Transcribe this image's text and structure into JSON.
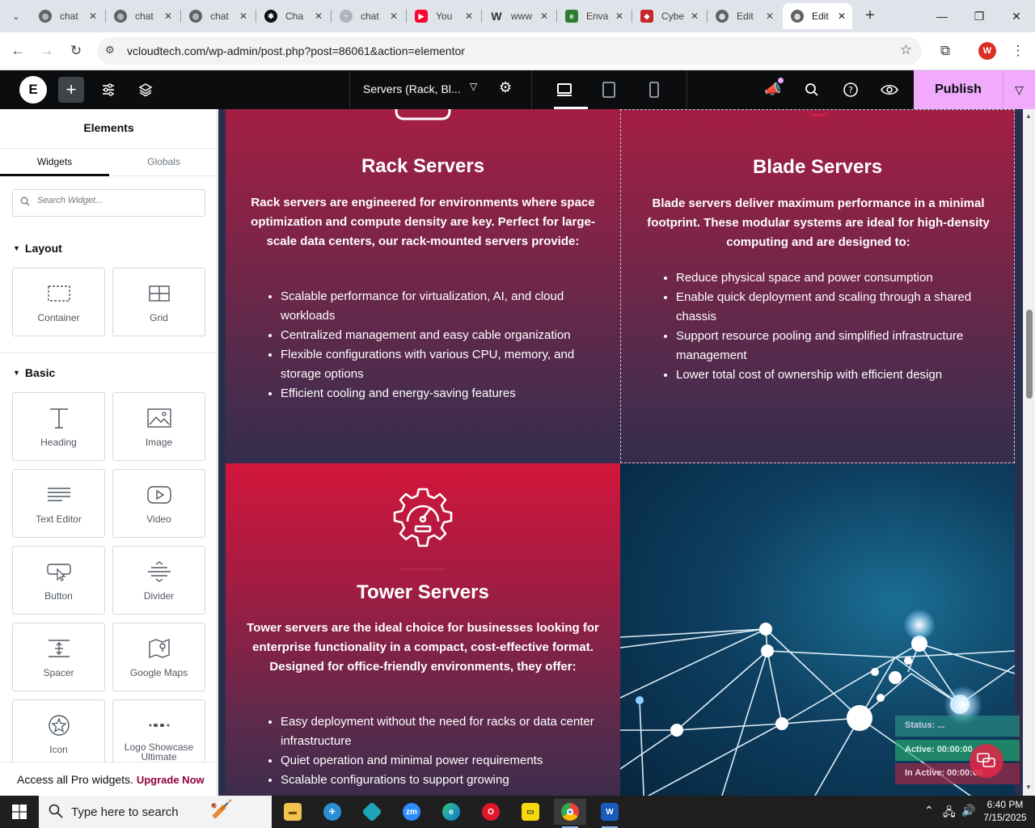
{
  "browser": {
    "tabs": [
      {
        "title": "chat",
        "icon": "openai-icon",
        "active": false
      },
      {
        "title": "chat",
        "icon": "openai-icon",
        "active": false
      },
      {
        "title": "chat",
        "icon": "openai-icon",
        "active": false
      },
      {
        "title": "Cha",
        "icon": "chatgpt-icon",
        "active": false
      },
      {
        "title": "chat",
        "icon": "deepseek-icon",
        "active": false
      },
      {
        "title": "You",
        "icon": "youtube-icon",
        "active": false
      },
      {
        "title": "www",
        "icon": "wordpress-icon",
        "active": false
      },
      {
        "title": "Enva",
        "icon": "envato-icon",
        "active": false
      },
      {
        "title": "Cybe",
        "icon": "cyber-icon",
        "active": false
      },
      {
        "title": "Edit",
        "icon": "globe-icon",
        "active": false
      },
      {
        "title": "Edit",
        "icon": "globe-icon",
        "active": true
      }
    ],
    "url": "vcloudtech.com/wp-admin/post.php?post=86061&action=elementor",
    "profile_initial": "W"
  },
  "elementor": {
    "logo": "E",
    "document_title": "Servers (Rack, Bl...",
    "publish_label": "Publish",
    "panel": {
      "title": "Elements",
      "tabs": [
        "Widgets",
        "Globals"
      ],
      "search_placeholder": "Search Widget...",
      "categories": {
        "layout": {
          "title": "Layout",
          "widgets": [
            "Container",
            "Grid"
          ]
        },
        "basic": {
          "title": "Basic",
          "widgets": [
            "Heading",
            "Image",
            "Text Editor",
            "Video",
            "Button",
            "Divider",
            "Spacer",
            "Google Maps",
            "Icon",
            "Logo Showcase Ultimate"
          ]
        }
      },
      "promo_text": "Access all Pro widgets.",
      "promo_link": "Upgrade Now"
    }
  },
  "canvas": {
    "rack": {
      "title": "Rack Servers",
      "description": "Rack servers are engineered for environments where space optimization and compute density are key. Perfect for large-scale data centers, our rack-mounted servers provide:",
      "items": [
        "Scalable performance for virtualization, AI, and cloud workloads",
        "Centralized management and easy cable organization",
        "Flexible configurations with various CPU, memory, and storage options",
        "Efficient cooling and energy-saving features"
      ]
    },
    "blade": {
      "title": "Blade Servers",
      "description": "Blade servers deliver maximum performance in a minimal footprint. These modular systems are ideal for high-density computing and are designed to:",
      "items": [
        "Reduce physical space and power consumption",
        "Enable quick deployment and scaling through a shared chassis",
        "Support resource pooling and simplified infrastructure management",
        "Lower total cost of ownership with efficient design"
      ]
    },
    "tower": {
      "title": "Tower Servers",
      "description": "Tower servers are the ideal choice for businesses looking for enterprise functionality in a compact, cost-effective format. Designed for office-friendly environments, they offer:",
      "items": [
        "Easy deployment without the need for racks or data center infrastructure",
        "Quiet operation and minimal power requirements",
        "Scalable configurations to support growing"
      ]
    },
    "status_overlay": {
      "status": "Status: ...",
      "active": "Active: 00:00:00",
      "inactive": "In Active: 00:00:00"
    }
  },
  "taskbar": {
    "search_placeholder": "Type here to search",
    "time": "6:40 PM",
    "date": "7/15/2025"
  },
  "colors": {
    "accent_pink": "#f0abfc",
    "card_red": "#d2163b",
    "card_dark": "#372d4c"
  }
}
